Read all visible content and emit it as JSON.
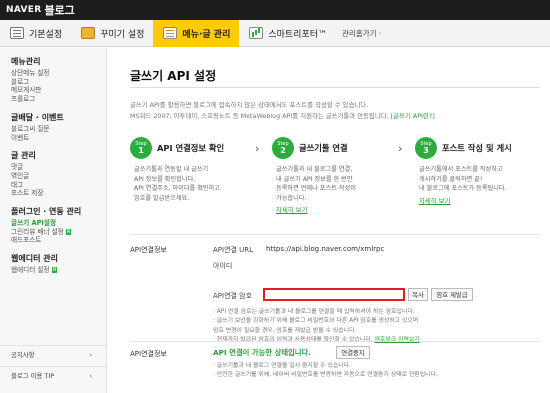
{
  "brand": {
    "naver": "NAVER",
    "blog": "블로그"
  },
  "tabs": [
    {
      "label": "기본설정"
    },
    {
      "label": "꾸미기 설정"
    },
    {
      "label": "메뉴·글 관리"
    },
    {
      "label": "스마트리포터™"
    }
  ],
  "tab_more": "관리홈가기 ·",
  "sidebar": {
    "groups": [
      {
        "title": "메뉴관리",
        "items": [
          "상단메뉴 설정",
          "블로그",
          "메모게시판",
          "프롤로그"
        ]
      },
      {
        "title": "글배달 · 이벤트",
        "items": [
          "블로그씨 질문",
          "이벤트"
        ]
      },
      {
        "title": "글 관리",
        "items": [
          "댓글",
          "엮인글",
          "태그",
          "포스트 저장"
        ]
      },
      {
        "title": "플러그인 · 연동 관리",
        "items": [
          "글쓰기 API설정",
          "그린리뷰 배너 설정",
          "애드포스트"
        ]
      },
      {
        "title": "웹에디터 관리",
        "items": [
          "웹에디터 설정"
        ]
      }
    ],
    "badge": "N",
    "footer": [
      "공지사항",
      "블로그 이용 TIP"
    ],
    "footer_arrow": "›"
  },
  "main": {
    "title": "글쓰기 API 설정",
    "desc_line1": "글쓰기 API를 활용하면 블로그에 접속하지 않은 상태에서도 포스트를 작성할 수 있습니다.",
    "desc_line2": "MS워드 2007, 이투데이, 스프링노트 등 MetaWeblog API를 지원하는 글쓰기툴과 연동됩니다.",
    "desc_link": "[글쓰기 API란?]",
    "steps": [
      {
        "num": "1",
        "title": "API 연결정보 확인",
        "lines": [
          "글쓰기툴과 연동할 내 글쓰기",
          "API 정보를 확인합니다.",
          "API 연결주소, 아이디를 확인하고",
          "암호를 발급받으세요."
        ],
        "link": ""
      },
      {
        "num": "2",
        "title": "글쓰기툴 연결",
        "lines": [
          "글쓰기툴과 내 블로그를 연결,",
          "내 글쓰기 API 정보를 한 번만",
          "등록하면 언제나 포스트 작성이",
          "가능합니다."
        ],
        "link": "자세히 보기"
      },
      {
        "num": "3",
        "title": "포스트 작성 및 게시",
        "lines": [
          "글쓰기툴에서 포스트를 작성하고",
          "게시하기를 클릭하면 끝!",
          "내 블로그에 포스트가 등록됩니다."
        ],
        "link": "자세히 보기"
      }
    ],
    "step_word": "Step",
    "arrow": "›",
    "section1_label": "API연결정보",
    "api_url_label": "API연결 URL",
    "api_url_value": "https://api.blog.naver.com/xmlrpc",
    "id_label": "아이디",
    "id_value": "",
    "pw_label": "API연결 암호",
    "copy_btn": "복사",
    "reissue_btn": "암호 재발급",
    "notes": [
      "· API 연결 암호는 글쓰기툴과 내 블로그를 연결할 때 입력하셔야 하는 암호입니다.",
      "· 글쓰기 보안을 강화하기 위해 블로그 비밀번호와 다른 API 암호를 생성하고 있으며",
      "  암호 변경이 필요할 경우, 암호를 재발급 받을 수 있습니다.",
      "· 현재까지 발급된 암호의 이력과 사용상태를 확인할 수 있습니다."
    ],
    "notes_link": "암호발급 이력보기",
    "section2_label": "API연결정보",
    "ok_text": "API 연결이 가능한 상태입니다.",
    "stop_btn": "연결중지",
    "notes2": [
      "· 글쓰기툴과 내 블로그 연결을 일시 중지할 수 있습니다.",
      "· 안전한 글쓰기를 위해, 네이버 비밀번호를 변경하면 자동으로 연결중지 상태로 전환됩니다."
    ]
  }
}
